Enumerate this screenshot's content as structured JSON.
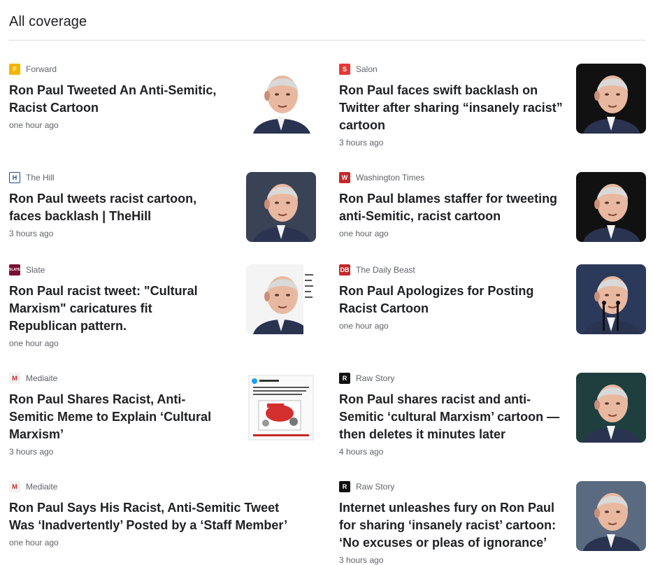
{
  "section": {
    "title": "All coverage"
  },
  "articles": [
    {
      "source": "Forward",
      "logo_text": "F",
      "logo_bg": "#f4b400",
      "logo_fg": "#ffffff",
      "headline": "Ron Paul Tweeted An Anti-Semitic, Racist Cartoon",
      "time": "one hour ago",
      "thumb_bg": "#ffffff"
    },
    {
      "source": "Salon",
      "logo_text": "S",
      "logo_bg": "#e53935",
      "logo_fg": "#ffffff",
      "headline": "Ron Paul faces swift backlash on Twitter after sharing “insanely racist” cartoon",
      "time": "3 hours ago",
      "thumb_bg": "#111111"
    },
    {
      "source": "The Hill",
      "logo_text": "H",
      "logo_bg": "#ffffff",
      "logo_fg": "#1a4e8a",
      "headline": "Ron Paul tweets racist cartoon, faces backlash | TheHill",
      "time": "3 hours ago",
      "thumb_bg": "#3a4256"
    },
    {
      "source": "Washington Times",
      "logo_text": "W",
      "logo_bg": "#c62828",
      "logo_fg": "#ffffff",
      "headline": "Ron Paul blames staffer for tweeting anti-Semitic, racist cartoon",
      "time": "one hour ago",
      "thumb_bg": "#111111"
    },
    {
      "source": "Slate",
      "logo_text": "SLATE",
      "logo_bg": "#7a1033",
      "logo_fg": "#ffffff",
      "headline": "Ron Paul racist tweet: \"Cultural Marxism\" caricatures fit Republican pattern.",
      "time": "one hour ago",
      "thumb_bg": "#f4f4f4"
    },
    {
      "source": "The Daily Beast",
      "logo_text": "DB",
      "logo_bg": "#c62828",
      "logo_fg": "#ffffff",
      "headline": "Ron Paul Apologizes for Posting Racist Cartoon",
      "time": "one hour ago",
      "thumb_bg": "#2b3a5a"
    },
    {
      "source": "Mediaite",
      "logo_text": "M",
      "logo_bg": "#f1f1f1",
      "logo_fg": "#c62828",
      "headline": "Ron Paul Shares Racist, Anti-Semitic Meme to Explain ‘Cultural Marxism’",
      "time": "3 hours ago",
      "thumb_bg": "#ffffff"
    },
    {
      "source": "Raw Story",
      "logo_text": "R",
      "logo_bg": "#111111",
      "logo_fg": "#ffffff",
      "headline": "Ron Paul shares racist and anti-Semitic ‘cultural Marxism’ cartoon — then deletes it minutes later",
      "time": "4 hours ago",
      "thumb_bg": "#1e3f3e"
    },
    {
      "source": "Mediaite",
      "logo_text": "M",
      "logo_bg": "#f1f1f1",
      "logo_fg": "#c62828",
      "headline": "Ron Paul Says His Racist, Anti-Semitic Tweet Was ‘Inadvertently’ Posted by a ‘Staff Member’",
      "time": "one hour ago",
      "thumb_bg": ""
    },
    {
      "source": "Raw Story",
      "logo_text": "R",
      "logo_bg": "#111111",
      "logo_fg": "#ffffff",
      "headline": "Internet unleashes fury on Ron Paul for sharing ‘insanely racist’ cartoon: ‘No excuses or pleas of ignorance’",
      "time": "3 hours ago",
      "thumb_bg": "#5a6a80"
    }
  ]
}
